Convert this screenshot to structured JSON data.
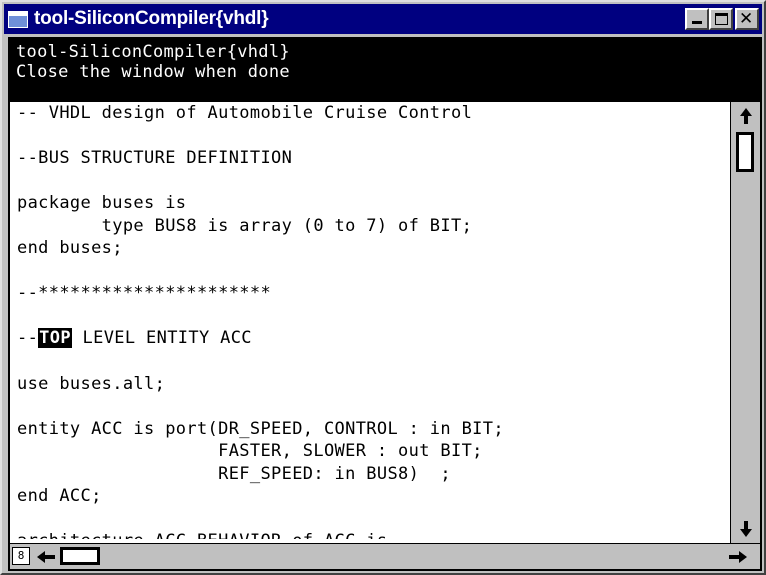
{
  "window": {
    "title": "tool-SiliconCompiler{vhdl}",
    "buttons": {
      "minimize": "minimize-icon",
      "maximize": "maximize-icon",
      "close": "close-icon"
    }
  },
  "message": {
    "lines": [
      "tool-SiliconCompiler{vhdl}",
      "Close the window when done"
    ]
  },
  "code": {
    "lines": [
      "-- VHDL design of Automobile Cruise Control",
      "",
      "--BUS STRUCTURE DEFINITION",
      "",
      "package buses is",
      "        type BUS8 is array (0 to 7) of BIT;",
      "end buses;",
      "",
      "--**********************",
      "",
      "",
      "",
      "use buses.all;",
      "",
      "entity ACC is port(DR_SPEED, CONTROL : in BIT;",
      "                   FASTER, SLOWER : out BIT;",
      "                   REF_SPEED: in BUS8)  ;",
      "end ACC;",
      "",
      "architecture ACC_BEHAVIOR of ACC is"
    ],
    "highlight_line": {
      "prefix": "--",
      "selected": "TOP",
      "suffix": " LEVEL ENTITY ACC"
    }
  },
  "scrollbars": {
    "vertical": {
      "up_icon": "arrow-up-icon",
      "down_icon": "arrow-down-icon"
    },
    "horizontal": {
      "left_icon": "arrow-left-icon",
      "right_icon": "arrow-right-icon",
      "corner_glyph": "8"
    }
  }
}
